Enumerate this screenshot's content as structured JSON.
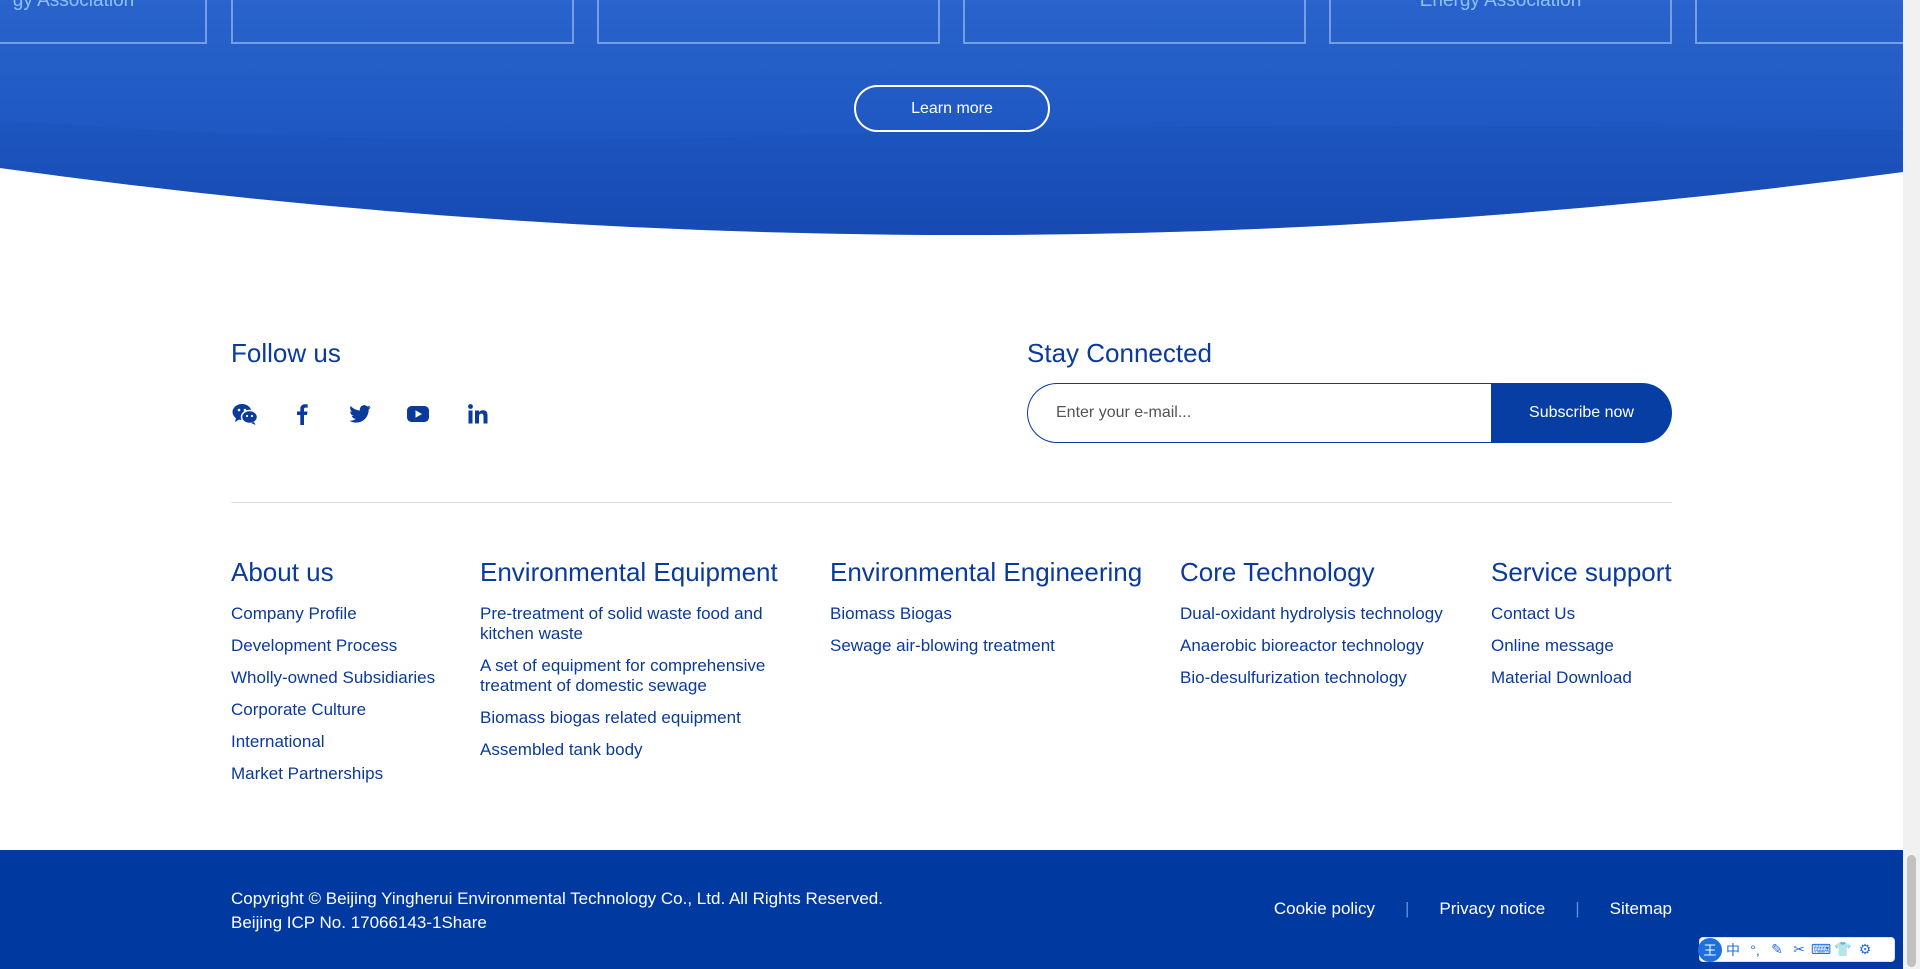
{
  "hero": {
    "cards": [
      {
        "text": "gy Association"
      },
      {
        "text": ""
      },
      {
        "text": ""
      },
      {
        "text": ""
      },
      {
        "text": "Energy Association"
      },
      {
        "text": ""
      }
    ],
    "learn_more_label": "Learn more"
  },
  "follow": {
    "title": "Follow us",
    "icons": [
      "wechat-icon",
      "facebook-icon",
      "twitter-icon",
      "youtube-icon",
      "linkedin-icon"
    ]
  },
  "subscribe": {
    "title": "Stay Connected",
    "email_placeholder": "Enter your e-mail...",
    "email_value": "",
    "button_label": "Subscribe now"
  },
  "columns": [
    {
      "title": "About us",
      "links": [
        "Company Profile",
        "Development Process",
        "Wholly-owned Subsidiaries",
        "Corporate Culture",
        "International",
        "Market Partnerships"
      ]
    },
    {
      "title": "Environmental Equipment",
      "links": [
        "Pre-treatment of solid waste food and kitchen waste",
        "A set of equipment for comprehensive treatment of domestic sewage",
        "Biomass biogas related equipment",
        "Assembled tank body"
      ]
    },
    {
      "title": "Environmental Engineering",
      "links": [
        "Biomass Biogas",
        "Sewage air-blowing treatment"
      ]
    },
    {
      "title": "Core Technology",
      "links": [
        "Dual-oxidant hydrolysis technology",
        "Anaerobic bioreactor technology",
        "Bio-desulfurization technology"
      ]
    },
    {
      "title": "Service support",
      "links": [
        "Contact Us",
        "Online message",
        "Material Download"
      ]
    }
  ],
  "footer": {
    "copyright": "Copyright © Beijing Yingherui Environmental Technology Co., Ltd. All Rights Reserved.",
    "icp": "Beijing ICP No. 17066143-1Share",
    "links": [
      "Cookie policy",
      "Privacy notice",
      "Sitemap"
    ],
    "separator": "|"
  },
  "ime_toolbar": {
    "logo": "王",
    "items": [
      "中",
      "°,",
      "✎",
      "✂",
      "⌨",
      "👕",
      "⚙"
    ]
  },
  "colors": {
    "brand_blue": "#0a3a9a",
    "hero_blue": "#1f57c0",
    "footer_blue": "#003aa0",
    "button_blue": "#073ea3"
  }
}
